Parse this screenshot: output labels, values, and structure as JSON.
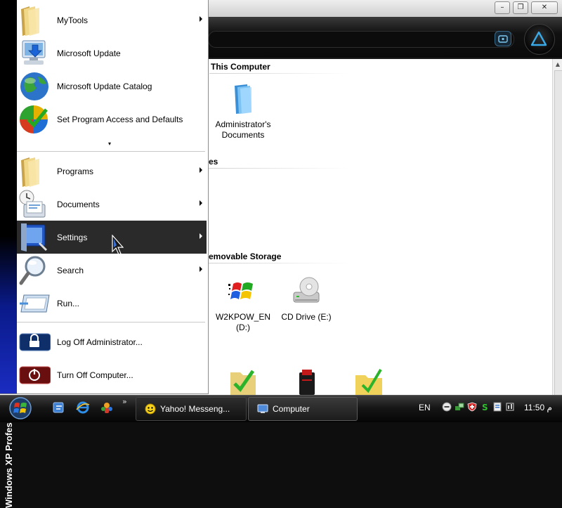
{
  "explorer": {
    "groups": [
      {
        "title": "This Computer"
      },
      {
        "title": "es"
      },
      {
        "title": "emovable Storage"
      }
    ],
    "items": {
      "admin_documents": "Administrator's Documents",
      "w2kpow_drive": "W2KPOW_EN (D:)",
      "cd_drive": "CD Drive (E:)"
    }
  },
  "start_menu": {
    "banner": "Windows XP Professional",
    "pinned": [
      {
        "label": "MyTools",
        "submenu": true,
        "icon": "folder-icon"
      },
      {
        "label": "Microsoft Update",
        "submenu": false,
        "icon": "monitor-update-icon"
      },
      {
        "label": "Microsoft Update Catalog",
        "submenu": false,
        "icon": "globe-icon"
      },
      {
        "label": "Set Program Access and Defaults",
        "submenu": false,
        "icon": "program-access-icon"
      }
    ],
    "more_glyph": "▾",
    "main": [
      {
        "label": "Programs",
        "submenu": true,
        "icon": "folder-icon"
      },
      {
        "label": "Documents",
        "submenu": true,
        "icon": "documents-icon"
      },
      {
        "label": "Settings",
        "submenu": true,
        "icon": "settings-icon",
        "highlighted": true
      },
      {
        "label": "Search",
        "submenu": true,
        "icon": "search-icon"
      },
      {
        "label": "Run...",
        "submenu": false,
        "icon": "run-icon"
      }
    ],
    "footer": [
      {
        "label": "Log Off Administrator...",
        "icon": "lock-icon"
      },
      {
        "label": "Turn Off Computer...",
        "icon": "power-icon"
      }
    ]
  },
  "taskbar": {
    "quicklaunch_more": "»",
    "tasks": [
      {
        "label": "Yahoo! Messeng...",
        "icon": "yahoo-smiley-icon"
      },
      {
        "label": "Computer",
        "icon": "computer-icon"
      }
    ],
    "language": "EN",
    "clock": "11:50 م"
  },
  "colors": {
    "menu_highlight": "#2a2a2a",
    "banner_blue": "#1a2cc0",
    "taskbar": "#111111"
  }
}
